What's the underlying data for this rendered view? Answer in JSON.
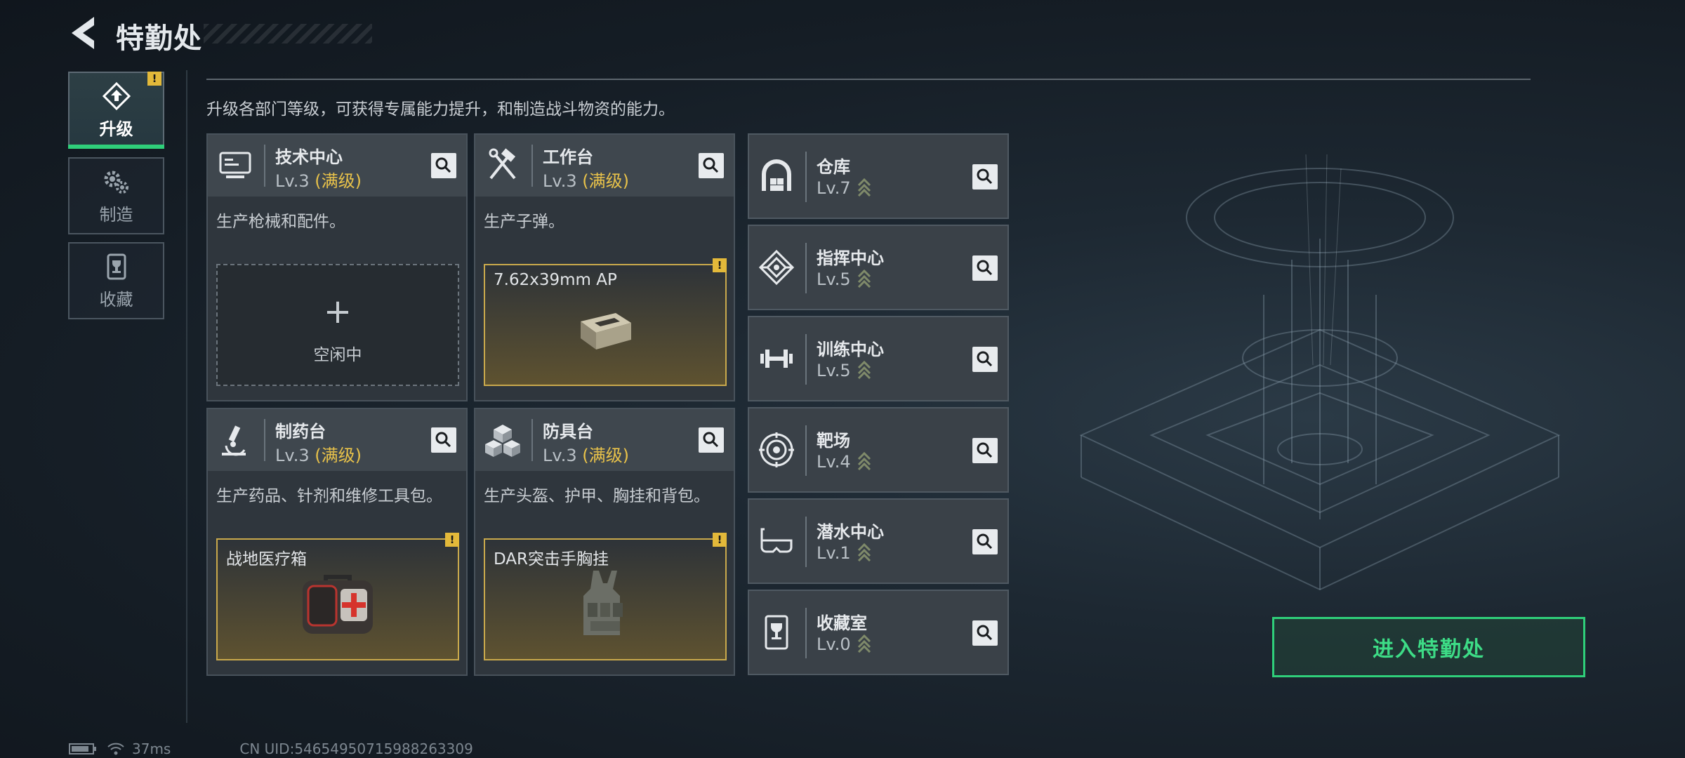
{
  "header": {
    "title": "特勤处"
  },
  "nav": [
    {
      "label": "升级",
      "active": true,
      "warn": "!"
    },
    {
      "label": "制造",
      "active": false
    },
    {
      "label": "收藏",
      "active": false
    }
  ],
  "description": "升级各部门等级，可获得专属能力提升，和制造战斗物资的能力。",
  "cards": [
    {
      "name": "技术中心",
      "lv": "Lv.3",
      "max": "(满级)",
      "sub": "生产枪械和配件。",
      "slot_plus": "+",
      "slot_text": "空闲中"
    },
    {
      "name": "工作台",
      "lv": "Lv.3",
      "max": "(满级)",
      "sub": "生产子弹。",
      "slot_text": "7.62x39mm AP",
      "warn": "!"
    },
    {
      "name": "制药台",
      "lv": "Lv.3",
      "max": "(满级)",
      "sub": "生产药品、针剂和维修工具包。",
      "slot_text": "战地医疗箱",
      "warn": "!"
    },
    {
      "name": "防具台",
      "lv": "Lv.3",
      "max": "(满级)",
      "sub": "生产头盔、护甲、胸挂和背包。",
      "slot_text": "DAR突击手胸挂",
      "warn": "!"
    }
  ],
  "rows": [
    {
      "name": "仓库",
      "lv": "Lv.7"
    },
    {
      "name": "指挥中心",
      "lv": "Lv.5"
    },
    {
      "name": "训练中心",
      "lv": "Lv.5"
    },
    {
      "name": "靶场",
      "lv": "Lv.4"
    },
    {
      "name": "潜水中心",
      "lv": "Lv.1"
    },
    {
      "name": "收藏室",
      "lv": "Lv.0"
    }
  ],
  "enter_button": "进入特勤处",
  "status": {
    "ping": "37ms",
    "uid": "CN UID:54654950715988263309"
  },
  "colors": {
    "accent_green": "#2fcf7a",
    "max_gold": "#e8c24a",
    "warn": "#e3b93a"
  }
}
